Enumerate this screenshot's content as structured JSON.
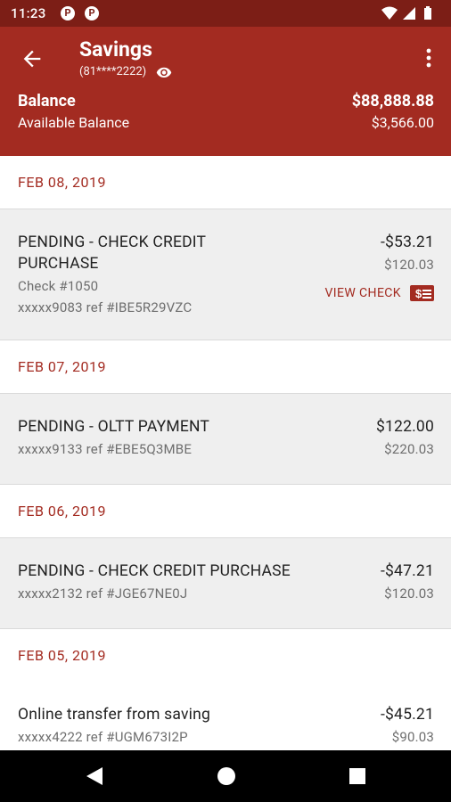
{
  "status_bar": {
    "time": "11:23",
    "app_icon_1": "P",
    "app_icon_2": "P"
  },
  "header": {
    "title": "Savings",
    "account_number": "(81****2222)",
    "balance_label": "Balance",
    "balance_value": "$88,888.88",
    "available_label": "Available Balance",
    "available_value": "$3,566.00",
    "color": "#a32b21"
  },
  "groups": [
    {
      "date": "FEB 08, 2019",
      "transaction": {
        "desc_line1": "PENDING - CHECK CREDIT",
        "desc_line2": "PURCHASE",
        "check_number": "Check #1050",
        "ref": "xxxxx9083 ref #IBE5R29VZC",
        "amount": "-$53.21",
        "running": "$120.03",
        "view_check_label": "VIEW CHECK",
        "view_check_icon": "$"
      }
    },
    {
      "date": "FEB 07, 2019",
      "transaction": {
        "desc": "PENDING - OLTT PAYMENT",
        "ref": "xxxxx9133 ref #EBE5Q3MBE",
        "amount": "$122.00",
        "running": "$220.03"
      }
    },
    {
      "date": "FEB 06, 2019",
      "transaction": {
        "desc": "PENDING - CHECK CREDIT PURCHASE",
        "ref": "xxxxx2132 ref #JGE67NE0J",
        "amount": "-$47.21",
        "running": "$120.03"
      }
    },
    {
      "date": "FEB 05, 2019",
      "transaction": {
        "desc": "Online transfer from saving",
        "ref": "xxxxx4222 ref #UGM673I2P",
        "amount": "-$45.21",
        "running": "$90.03"
      }
    }
  ]
}
